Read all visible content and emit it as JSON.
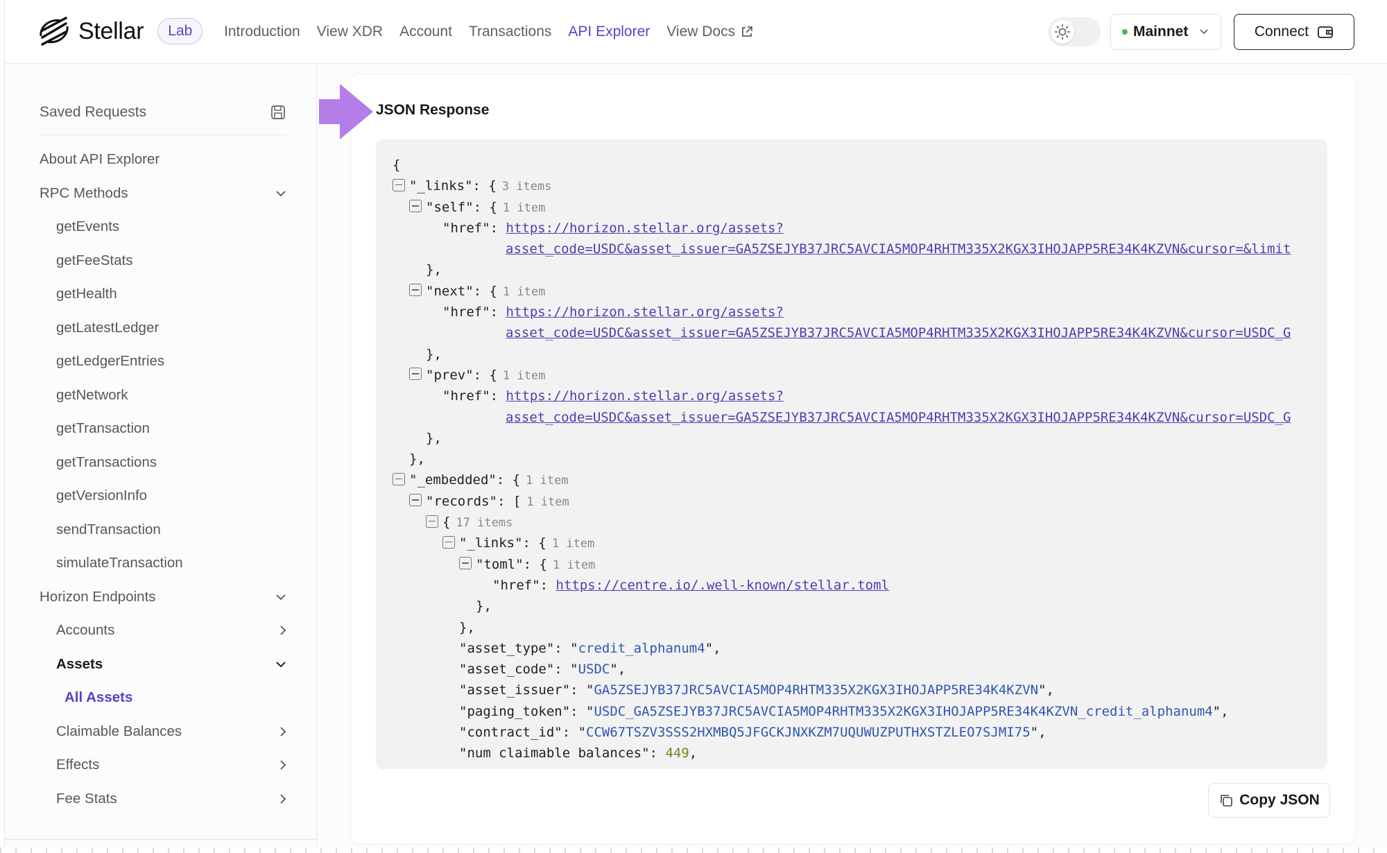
{
  "header": {
    "brand": "Stellar",
    "lab_badge": "Lab",
    "nav": [
      {
        "label": "Introduction",
        "active": false
      },
      {
        "label": "View XDR",
        "active": false
      },
      {
        "label": "Account",
        "active": false
      },
      {
        "label": "Transactions",
        "active": false
      },
      {
        "label": "API Explorer",
        "active": true
      },
      {
        "label": "View Docs",
        "active": false,
        "external": true
      }
    ],
    "network": "Mainnet",
    "network_status_color": "#3fb950",
    "connect_label": "Connect"
  },
  "sidebar": {
    "saved_requests": "Saved Requests",
    "items": [
      {
        "label": "About API Explorer",
        "level": 0
      },
      {
        "label": "RPC Methods",
        "level": 0,
        "chevron": "down"
      },
      {
        "label": "getEvents",
        "level": 1
      },
      {
        "label": "getFeeStats",
        "level": 1
      },
      {
        "label": "getHealth",
        "level": 1
      },
      {
        "label": "getLatestLedger",
        "level": 1
      },
      {
        "label": "getLedgerEntries",
        "level": 1
      },
      {
        "label": "getNetwork",
        "level": 1
      },
      {
        "label": "getTransaction",
        "level": 1
      },
      {
        "label": "getTransactions",
        "level": 1
      },
      {
        "label": "getVersionInfo",
        "level": 1
      },
      {
        "label": "sendTransaction",
        "level": 1
      },
      {
        "label": "simulateTransaction",
        "level": 1
      },
      {
        "label": "Horizon Endpoints",
        "level": 0,
        "chevron": "down"
      },
      {
        "label": "Accounts",
        "level": 1,
        "chevron": "right"
      },
      {
        "label": "Assets",
        "level": 1,
        "chevron": "down",
        "bold": true
      },
      {
        "label": "All Assets",
        "level": 2,
        "selected": true
      },
      {
        "label": "Claimable Balances",
        "level": 1,
        "chevron": "right"
      },
      {
        "label": "Effects",
        "level": 1,
        "chevron": "right"
      },
      {
        "label": "Fee Stats",
        "level": 1,
        "chevron": "right"
      }
    ]
  },
  "main": {
    "title": "JSON Response",
    "copy_label": "Copy JSON",
    "json": {
      "links_key": "\"_links\"",
      "links_count": "3 items",
      "self_key": "\"self\"",
      "next_key": "\"next\"",
      "prev_key": "\"prev\"",
      "one_item": "1 item",
      "href_key": "\"href\"",
      "href_prefix": "https://horizon.stellar.org/assets?",
      "self_href_rest": "asset_code=USDC&asset_issuer=GA5ZSEJYB37JRC5AVCIA5MOP4RHTM335X2KGX3IHOJAPP5RE34K4KZVN&cursor=&limit",
      "next_href_rest": "asset_code=USDC&asset_issuer=GA5ZSEJYB37JRC5AVCIA5MOP4RHTM335X2KGX3IHOJAPP5RE34K4KZVN&cursor=USDC_G",
      "prev_href_rest": "asset_code=USDC&asset_issuer=GA5ZSEJYB37JRC5AVCIA5MOP4RHTM335X2KGX3IHOJAPP5RE34K4KZVN&cursor=USDC_G",
      "embedded_key": "\"_embedded\"",
      "records_key": "\"records\"",
      "record_count": "17 items",
      "toml_key": "\"toml\"",
      "toml_href": "https://centre.io/.well-known/stellar.toml",
      "asset_type_key": "\"asset_type\"",
      "asset_type": "credit_alphanum4",
      "asset_code_key": "\"asset_code\"",
      "asset_code": "USDC",
      "asset_issuer_key": "\"asset_issuer\"",
      "asset_issuer": "GA5ZSEJYB37JRC5AVCIA5MOP4RHTM335X2KGX3IHOJAPP5RE34K4KZVN",
      "paging_token_key": "\"paging_token\"",
      "paging_token": "USDC_GA5ZSEJYB37JRC5AVCIA5MOP4RHTM335X2KGX3IHOJAPP5RE34K4KZVN_credit_alphanum4",
      "contract_id_key": "\"contract_id\"",
      "contract_id": "CCW67TSZV3SSS2HXMBQ5JFGCKJNXKZM7UQUWUZPUTHXSTZLEO7SJMI75",
      "num_claimable_key": "\"num_claimable_balances\"",
      "num_claimable": "449"
    }
  },
  "colors": {
    "accent": "#5b3fc4",
    "arrow": "#b57de8",
    "link": "#4a3fb0"
  }
}
